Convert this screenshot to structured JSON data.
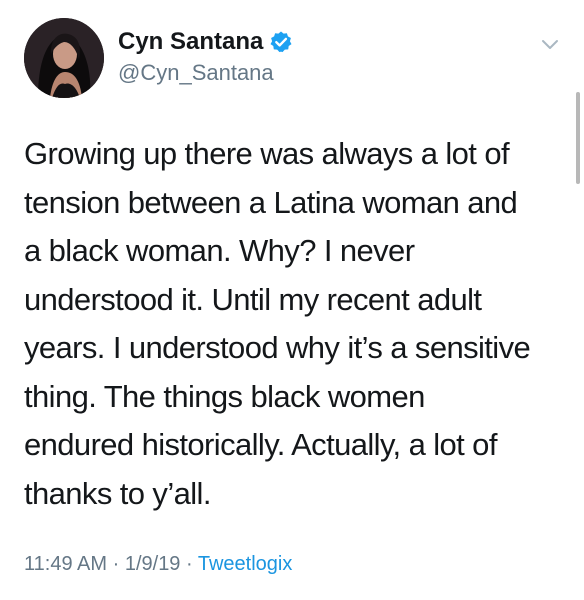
{
  "tweet": {
    "author": {
      "display_name": "Cyn Santana",
      "handle": "@Cyn_Santana",
      "verified": true,
      "avatar_icon": "profile-photo"
    },
    "text_lines": [
      "Growing up there was always a lot of",
      "tension between a Latina woman and",
      "a black woman. Why? I never",
      "understood it. Until my recent adult",
      "years. I understood why it’s a sensitive",
      "thing. The things black women",
      "endured historically. Actually, a lot of",
      "thanks to y’all."
    ],
    "meta": {
      "time": "11:49 AM",
      "separator": "·",
      "date": "1/9/19",
      "source": "Tweetlogix"
    }
  },
  "icons": {
    "verified": "verified-badge-icon",
    "menu": "chevron-down-icon"
  },
  "colors": {
    "text": "#14171a",
    "secondary": "#657786",
    "link": "#1b95e0",
    "verified": "#1da1f2"
  }
}
